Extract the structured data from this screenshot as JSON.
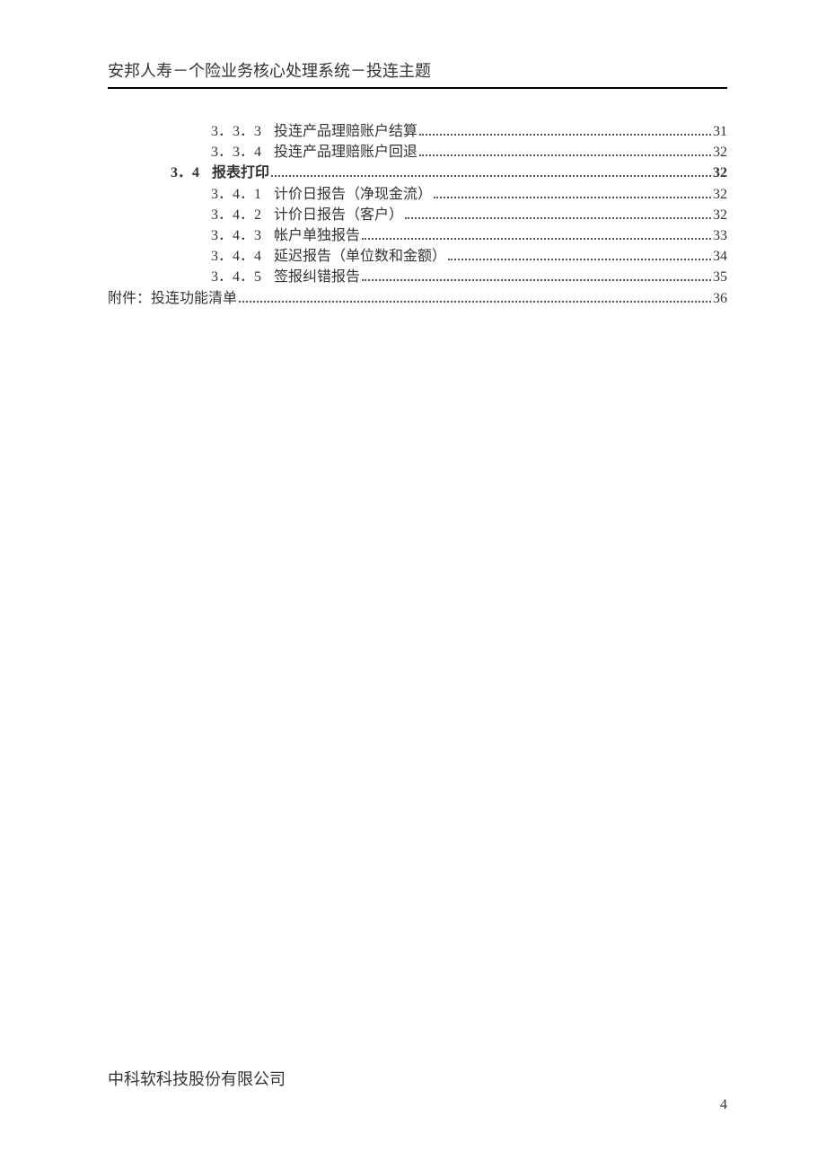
{
  "header": "安邦人寿－个险业务核心处理系统－投连主题",
  "toc": [
    {
      "level": "l3",
      "num": "3．3．3",
      "title": "投连产品理赔账户结算",
      "page": "31",
      "bold": false
    },
    {
      "level": "l3",
      "num": "3．3．4",
      "title": "投连产品理赔账户回退",
      "page": "32",
      "bold": false
    },
    {
      "level": "l2",
      "num": "3．4",
      "title": "报表打印",
      "page": "32",
      "bold": true
    },
    {
      "level": "l3",
      "num": "3．4．1",
      "title": "计价日报告（净现金流）",
      "page": "32",
      "bold": false
    },
    {
      "level": "l3",
      "num": "3．4．2",
      "title": "计价日报告（客户）",
      "page": "32",
      "bold": false
    },
    {
      "level": "l3",
      "num": "3．4．3",
      "title": "帐户单独报告",
      "page": "33",
      "bold": false
    },
    {
      "level": "l3",
      "num": "3．4．4",
      "title": "延迟报告（单位数和金额）",
      "page": "34",
      "bold": false
    },
    {
      "level": "l3",
      "num": "3．4．5",
      "title": "签报纠错报告",
      "page": "35",
      "bold": false
    },
    {
      "level": "l1",
      "num": "",
      "title": "附件：投连功能清单",
      "page": "36",
      "bold": false
    }
  ],
  "footer": "中科软科技股份有限公司",
  "pageNumber": "4"
}
